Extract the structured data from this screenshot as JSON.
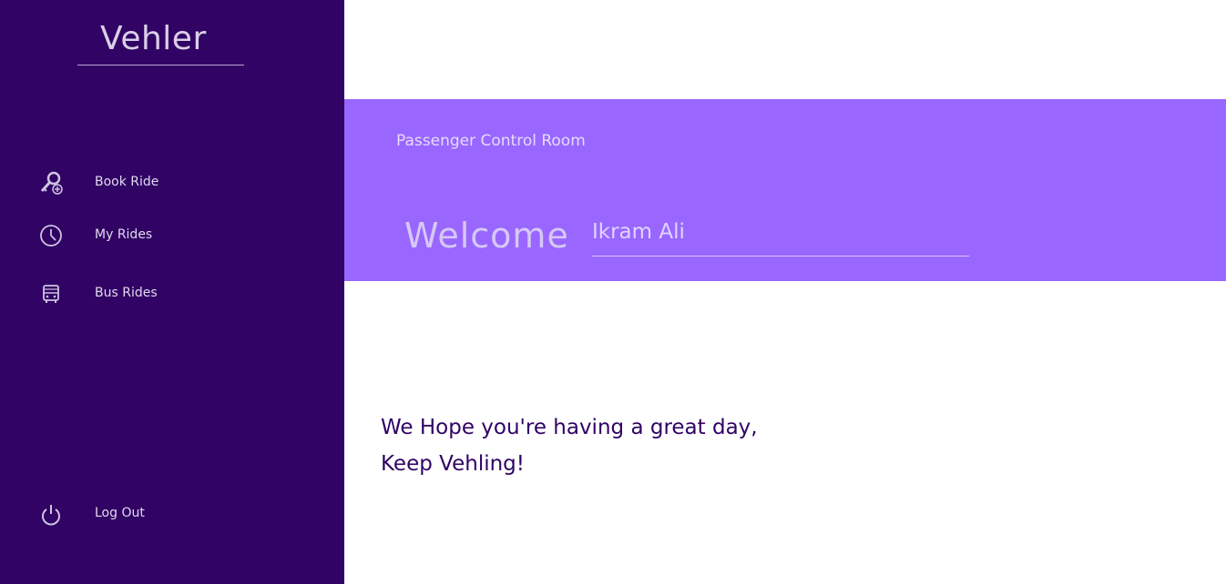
{
  "sidebar": {
    "brand": "Vehler",
    "items": [
      {
        "label": "Book Ride",
        "icon": "key-add-icon"
      },
      {
        "label": "My Rides",
        "icon": "clock-icon"
      },
      {
        "label": "Bus Rides",
        "icon": "bus-icon"
      }
    ],
    "logout": {
      "label": "Log Out",
      "icon": "power-icon"
    }
  },
  "banner": {
    "subtitle": "Passenger Control Room",
    "welcome": "Welcome",
    "name_value": "Ikram Ali"
  },
  "main": {
    "line1": "We Hope you're having a great day,",
    "line2": "Keep Vehling!"
  },
  "colors": {
    "sidebar_bg": "#300364",
    "banner_bg": "#9966ff",
    "text_dark": "#300364"
  }
}
